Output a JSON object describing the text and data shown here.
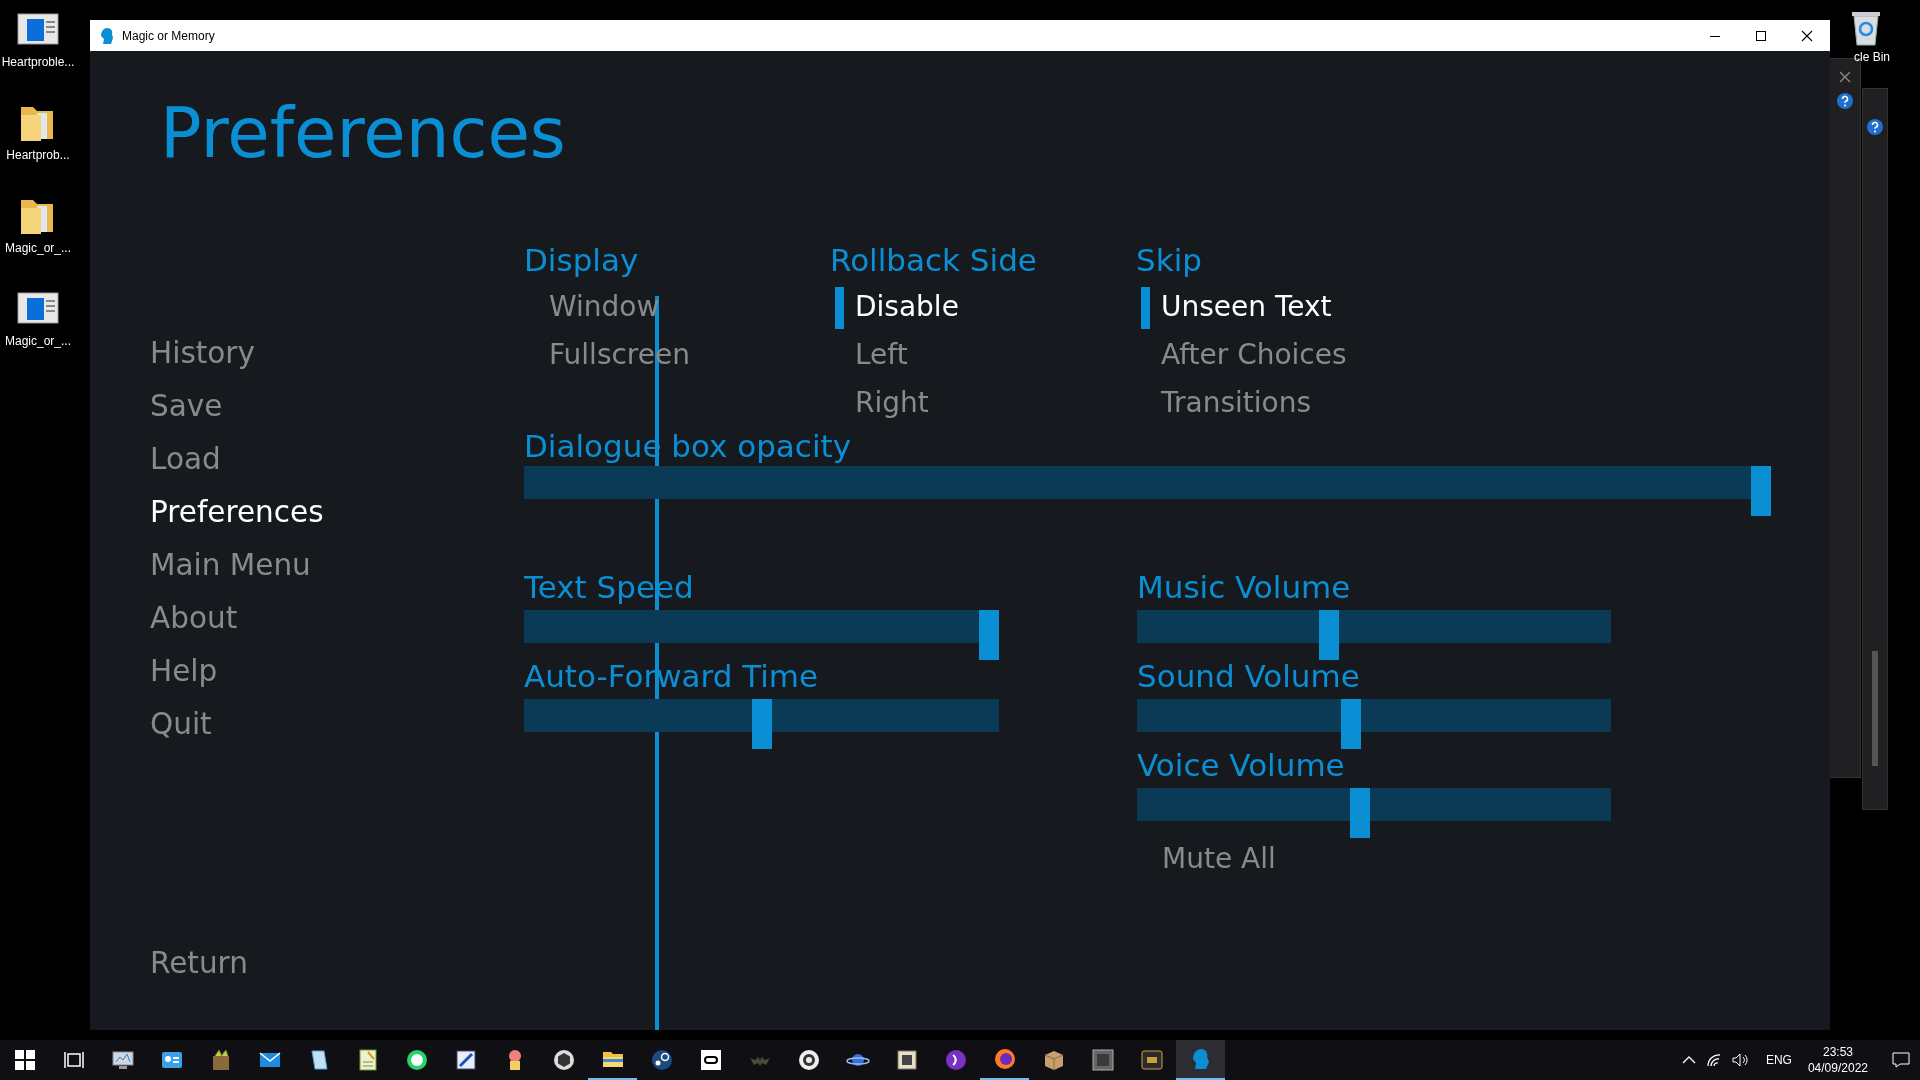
{
  "desktop": {
    "icons": [
      {
        "kind": "document",
        "label": "Heartproble..."
      },
      {
        "kind": "folder",
        "label": "Heartprob..."
      },
      {
        "kind": "folder",
        "label": "Magic_or_..."
      },
      {
        "kind": "document",
        "label": "Magic_or_..."
      }
    ],
    "recycle_bin": {
      "label": "cle Bin"
    }
  },
  "window": {
    "title": "Magic or Memory",
    "heading": "Preferences",
    "nav": [
      {
        "label": "History",
        "selected": false
      },
      {
        "label": "Save",
        "selected": false
      },
      {
        "label": "Load",
        "selected": false
      },
      {
        "label": "Preferences",
        "selected": true
      },
      {
        "label": "Main Menu",
        "selected": false
      },
      {
        "label": "About",
        "selected": false
      },
      {
        "label": "Help",
        "selected": false
      },
      {
        "label": "Quit",
        "selected": false
      }
    ],
    "return": "Return",
    "choices": [
      {
        "title": "Display",
        "options": [
          {
            "label": "Window",
            "selected": false
          },
          {
            "label": "Fullscreen",
            "selected": false
          }
        ]
      },
      {
        "title": "Rollback Side",
        "options": [
          {
            "label": "Disable",
            "selected": true
          },
          {
            "label": "Left",
            "selected": false
          },
          {
            "label": "Right",
            "selected": false
          }
        ]
      },
      {
        "title": "Skip",
        "options": [
          {
            "label": "Unseen Text",
            "selected": true
          },
          {
            "label": "After Choices",
            "selected": false
          },
          {
            "label": "Transitions",
            "selected": false
          }
        ]
      }
    ],
    "opacity_slider": {
      "label": "Dialogue box opacity",
      "level": 1
    },
    "left_sliders": [
      {
        "label": "Text Speed",
        "level": 1
      },
      {
        "label": "Auto-Forward Time",
        "level": 0.5
      }
    ],
    "volume_sliders": [
      {
        "label": "Music Volume",
        "level": 0.4
      },
      {
        "label": "Sound Volume",
        "level": 0.45
      },
      {
        "label": "Voice Volume",
        "level": 0.47
      }
    ],
    "mute_all": {
      "label": "Mute All",
      "selected": false
    }
  },
  "taskbar": {
    "apps": [
      {
        "kind": "start",
        "running": false,
        "selected": false
      },
      {
        "kind": "taskview",
        "running": false,
        "selected": false
      },
      {
        "kind": "monitor",
        "running": false,
        "selected": false
      },
      {
        "kind": "card",
        "running": false,
        "selected": false
      },
      {
        "kind": "books",
        "running": false,
        "selected": false
      },
      {
        "kind": "mail",
        "running": false,
        "selected": false
      },
      {
        "kind": "notepad",
        "running": false,
        "selected": false
      },
      {
        "kind": "sheet",
        "running": false,
        "selected": false
      },
      {
        "kind": "chat",
        "running": false,
        "selected": false
      },
      {
        "kind": "paint",
        "running": false,
        "selected": false
      },
      {
        "kind": "character",
        "running": false,
        "selected": false
      },
      {
        "kind": "cube",
        "running": false,
        "selected": false
      },
      {
        "kind": "folder",
        "running": true,
        "selected": false
      },
      {
        "kind": "steam",
        "running": false,
        "selected": false
      },
      {
        "kind": "ring",
        "running": false,
        "selected": false
      },
      {
        "kind": "bat",
        "running": false,
        "selected": false
      },
      {
        "kind": "gear",
        "running": false,
        "selected": false
      },
      {
        "kind": "planet",
        "running": false,
        "selected": false
      },
      {
        "kind": "tile",
        "running": false,
        "selected": false
      },
      {
        "kind": "orb",
        "running": false,
        "selected": false
      },
      {
        "kind": "fox",
        "running": true,
        "selected": false
      },
      {
        "kind": "box",
        "running": false,
        "selected": false
      },
      {
        "kind": "frame",
        "running": false,
        "selected": false
      },
      {
        "kind": "darktile",
        "running": false,
        "selected": false
      },
      {
        "kind": "game",
        "running": true,
        "selected": true
      }
    ],
    "tray": {
      "language": "ENG",
      "time": "23:53",
      "date": "04/09/2022"
    }
  }
}
